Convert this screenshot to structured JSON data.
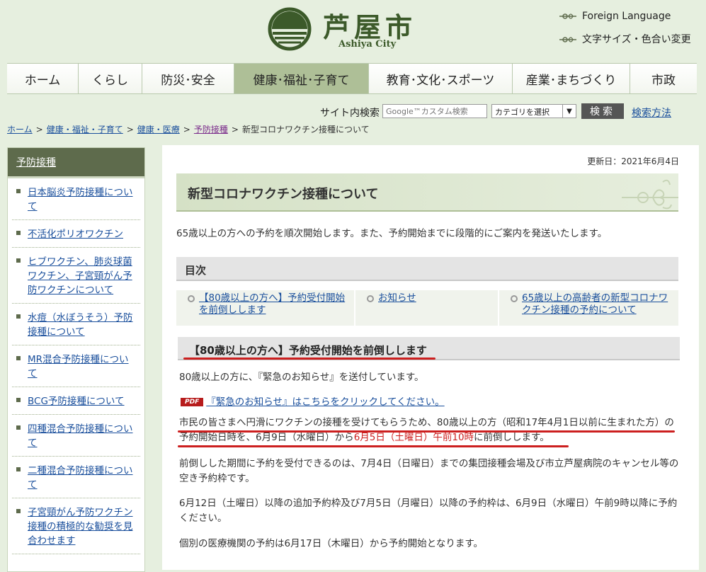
{
  "header": {
    "site_name": "芦屋市",
    "site_name_en": "Ashiya City",
    "foreign_language": "Foreign Language",
    "text_size_color": "文字サイズ・色合い変更"
  },
  "nav": {
    "items": [
      {
        "label": "ホーム"
      },
      {
        "label": "くらし"
      },
      {
        "label": "防災･安全"
      },
      {
        "label": "健康･福祉･子育て"
      },
      {
        "label": "教育･文化･スポーツ"
      },
      {
        "label": "産業･まちづくり"
      },
      {
        "label": "市政"
      }
    ],
    "active_index": 3
  },
  "search": {
    "label": "サイト内検索",
    "placeholder": "Google™カスタム検索",
    "category": "カテゴリを選択",
    "button": "検索",
    "help": "検索方法"
  },
  "breadcrumb": {
    "items": [
      "ホーム",
      "健康・福祉・子育て",
      "健康・医療",
      "予防接種"
    ],
    "separator": ">",
    "current": "新型コロナワクチン接種について"
  },
  "sidebar": {
    "title": "予防接種",
    "items": [
      "日本脳炎予防接種について",
      "不活化ポリオワクチン",
      "ヒブワクチン、肺炎球菌ワクチン、子宮頸がん予防ワクチンについて",
      "水痘（水ぼうそう）予防接種について",
      "MR混合予防接種について",
      "BCG予防接種について",
      "四種混合予防接種について",
      "二種混合予防接種について",
      "子宮頸がん予防ワクチン接種の積極的な勧奨を見合わせます"
    ]
  },
  "main": {
    "updated": "更新日：2021年6月4日",
    "title": "新型コロナワクチン接種について",
    "intro": "65歳以上の方への予約を順次開始します。また、予約開始までに段階的にご案内を発送いたします。",
    "toc_title": "目次",
    "toc": [
      "【80歳以上の方へ】予約受付開始を前倒しします",
      "お知らせ",
      "65歳以上の高齢者の新型コロナワクチン接種の予約について"
    ],
    "section_heading": "【80歳以上の方へ】予約受付開始を前倒しします",
    "p1": "80歳以上の方に、『緊急のお知らせ』を送付しています。",
    "pdf_badge": "PDF",
    "pdf_link": "『緊急のお知らせ』はこちらをクリックしてください。",
    "p2_a": "市民の皆さまへ円滑にワクチンの接種を受けてもらうため、80歳以上の方（昭和17年4月1日以前に生まれた方）の予約開始日時を、6月9日（水曜日）から",
    "p2_red": "6月5日（土曜日）午前10時",
    "p2_b": "に前倒しします。",
    "p3": "前倒しした期間に予約を受付できるのは、7月4日（日曜日）までの集団接種会場及び市立芦屋病院のキャンセル等の空き予約枠です。",
    "p4": "6月12日（土曜日）以降の追加予約枠及び7月5日（月曜日）以降の予約枠は、6月9日（水曜日）午前9時以降に予約ください。",
    "p5": "個別の医療機関の予約は6月17日（木曜日）から予約開始となります。"
  },
  "colors": {
    "page_bg": "#e6efdf",
    "nav_active": "#aebf97",
    "sidebar_header": "#5e6b4c",
    "link": "#1a4f9c",
    "emphasis_red": "#cc1f1f"
  }
}
